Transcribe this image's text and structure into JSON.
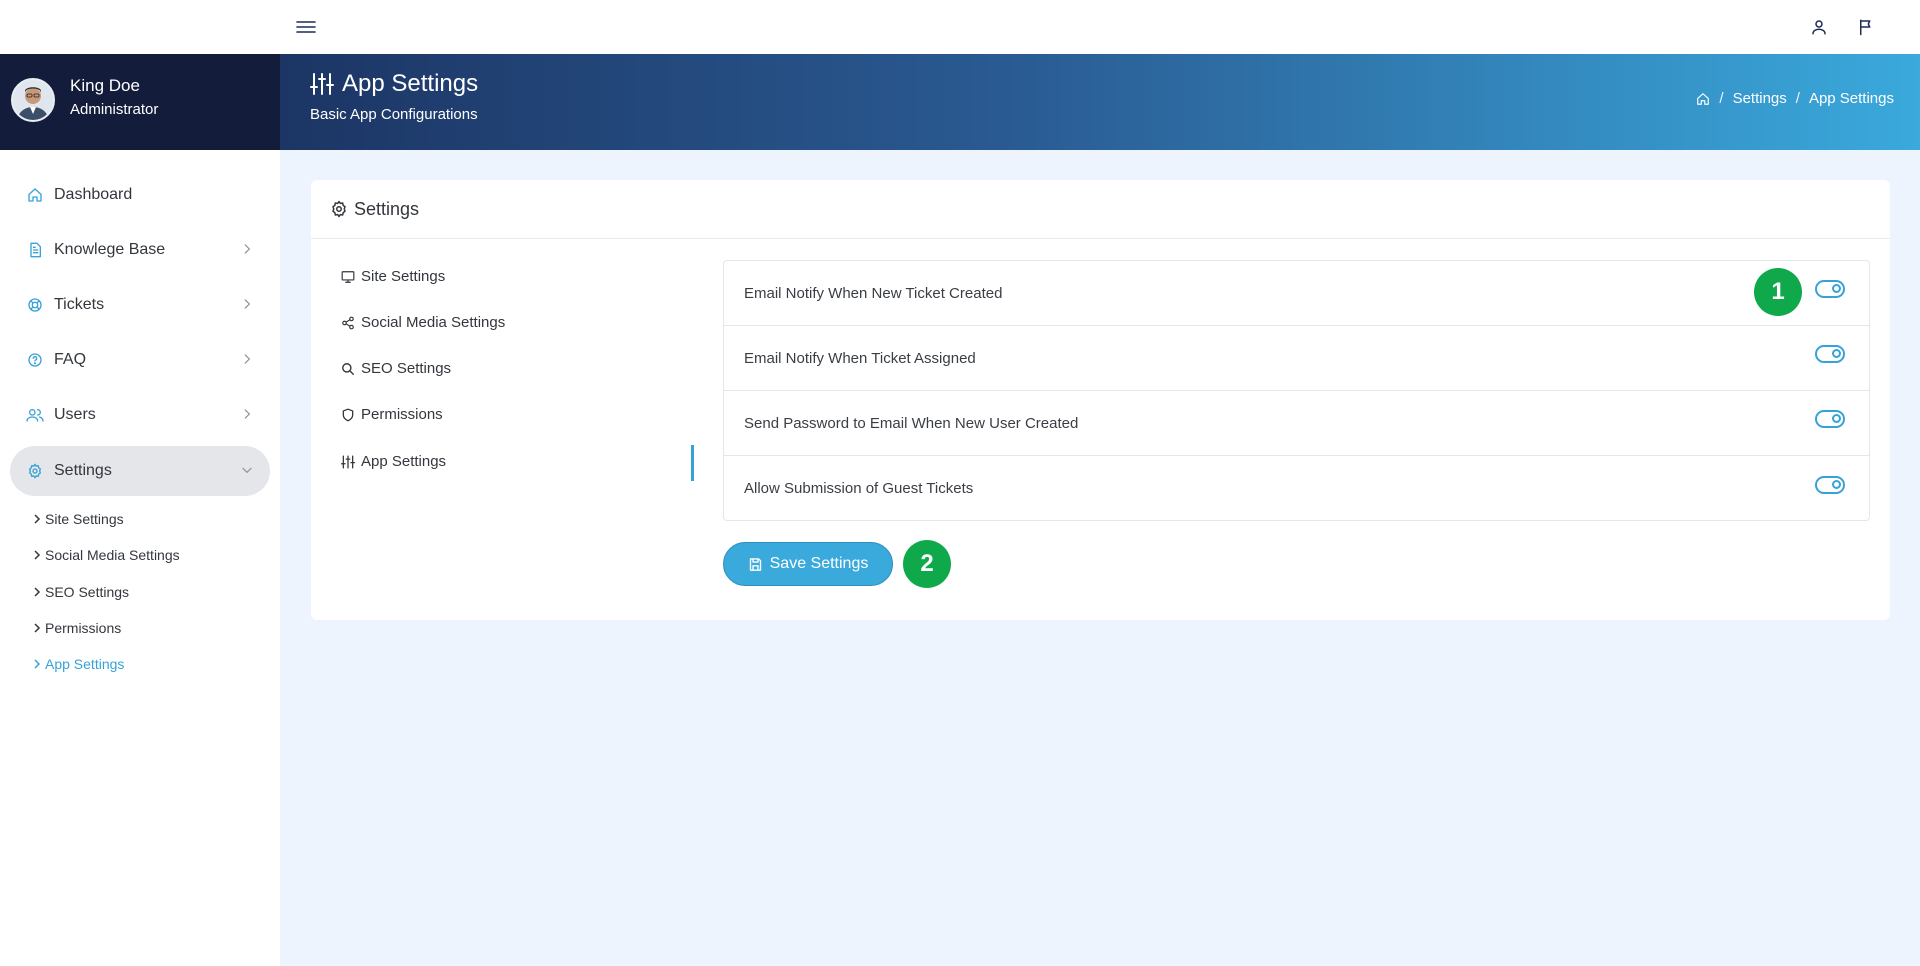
{
  "user": {
    "name": "King Doe",
    "role": "Administrator"
  },
  "banner": {
    "title": "App Settings",
    "subtitle": "Basic App Configurations"
  },
  "breadcrumb": {
    "items": [
      "Settings",
      "App Settings"
    ],
    "separator": "/"
  },
  "sidebar": {
    "items": [
      {
        "label": "Dashboard"
      },
      {
        "label": "Knowlege Base"
      },
      {
        "label": "Tickets"
      },
      {
        "label": "FAQ"
      },
      {
        "label": "Users"
      },
      {
        "label": "Settings"
      }
    ],
    "subitems": [
      {
        "label": "Site Settings"
      },
      {
        "label": "Social Media Settings"
      },
      {
        "label": "SEO Settings"
      },
      {
        "label": "Permissions"
      },
      {
        "label": "App Settings"
      }
    ],
    "active_item": "Settings",
    "active_subitem": "App Settings"
  },
  "card": {
    "title": "Settings",
    "tabs": [
      {
        "label": "Site Settings"
      },
      {
        "label": "Social Media Settings"
      },
      {
        "label": "SEO Settings"
      },
      {
        "label": "Permissions"
      },
      {
        "label": "App Settings"
      }
    ],
    "active_tab": "App Settings",
    "settings": [
      {
        "label": "Email Notify When New Ticket Created",
        "enabled": true
      },
      {
        "label": "Email Notify When Ticket Assigned",
        "enabled": true
      },
      {
        "label": "Send Password to Email When New User Created",
        "enabled": true
      },
      {
        "label": "Allow Submission of Guest Tickets",
        "enabled": true
      }
    ],
    "save_label": "Save Settings"
  },
  "markers": [
    "1",
    "2"
  ],
  "colors": {
    "accent": "#36a2d8",
    "sidebar_dark": "#141c3c",
    "marker": "#0fa84b",
    "page_bg": "#eef4fd"
  }
}
